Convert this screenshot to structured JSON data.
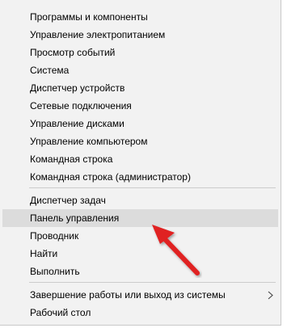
{
  "menu": {
    "groups": [
      {
        "items": [
          {
            "label": "Программы и компоненты"
          },
          {
            "label": "Управление электропитанием"
          },
          {
            "label": "Просмотр событий"
          },
          {
            "label": "Система"
          },
          {
            "label": "Диспетчер устройств"
          },
          {
            "label": "Сетевые подключения"
          },
          {
            "label": "Управление дисками"
          },
          {
            "label": "Управление компьютером"
          },
          {
            "label": "Командная строка"
          },
          {
            "label": "Командная строка (администратор)"
          }
        ]
      },
      {
        "items": [
          {
            "label": "Диспетчер задач"
          },
          {
            "label": "Панель управления",
            "highlighted": true
          },
          {
            "label": "Проводник"
          },
          {
            "label": "Найти"
          },
          {
            "label": "Выполнить"
          }
        ]
      },
      {
        "items": [
          {
            "label": "Завершение работы или выход из системы",
            "has_submenu": true
          },
          {
            "label": "Рабочий стол"
          }
        ]
      }
    ]
  },
  "colors": {
    "menu_background": "#f2f2f2",
    "highlight_background": "#dcdcdc",
    "separator": "#cccccc",
    "annotation_arrow": "#e02020"
  },
  "icons": {
    "submenu": "chevron-right-icon",
    "annotation": "red-pointer-arrow-icon"
  }
}
